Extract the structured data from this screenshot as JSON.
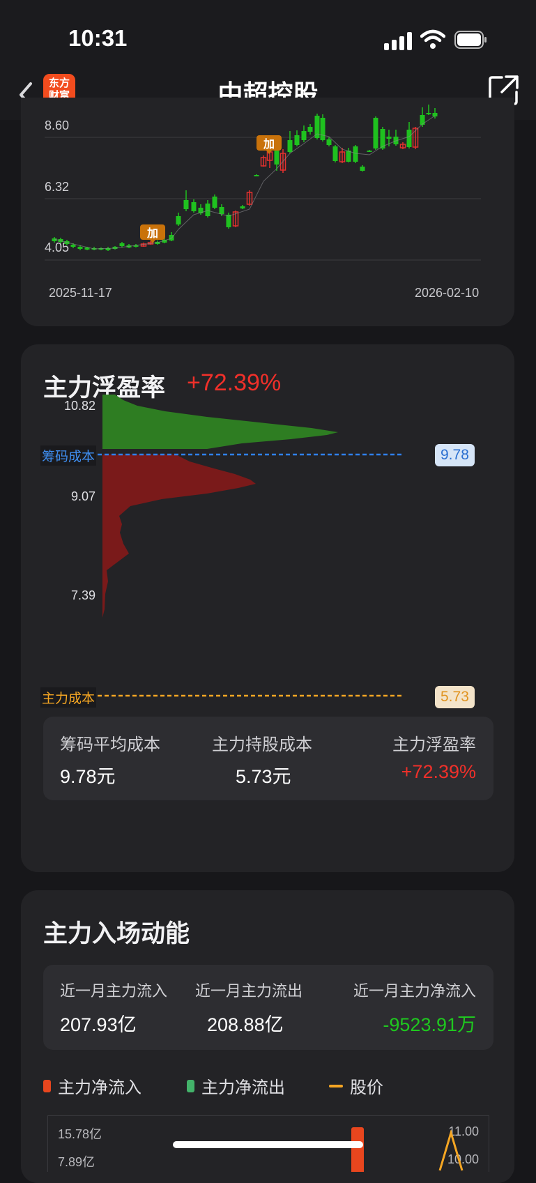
{
  "status_bar": {
    "time": "10:31"
  },
  "nav": {
    "logo_line1": "东方",
    "logo_line2": "财富",
    "title": "中超控股"
  },
  "kline": {
    "price_labels": [
      "8.60",
      "6.32",
      "4.05"
    ],
    "date_start": "2025-11-17",
    "date_end": "2026-02-10",
    "markers": [
      "加",
      "加"
    ],
    "up_color": "#e5312e",
    "down_color": "#1fc11f"
  },
  "profit_card": {
    "title": "主力浮盈率",
    "value": "+72.39%",
    "price_axis": [
      "10.82",
      "9.07",
      "7.39"
    ],
    "chip_cost_tag": "筹码成本",
    "chip_cost_value": "9.78",
    "main_cost_tag": "主力成本",
    "main_cost_value": "5.73",
    "summary": [
      {
        "label": "筹码平均成本",
        "value": "9.78元"
      },
      {
        "label": "主力持股成本",
        "value": "5.73元"
      },
      {
        "label": "主力浮盈率",
        "value": "+72.39%"
      }
    ],
    "colors": {
      "profit": "#2e7d22",
      "loss": "#7a1a1a",
      "chip_line": "#2f80ed",
      "main_line": "#f5a623"
    }
  },
  "flow_card": {
    "title": "主力入场动能",
    "summary": [
      {
        "label": "近一月主力流入",
        "value": "207.93亿"
      },
      {
        "label": "近一月主力流出",
        "value": "208.88亿"
      },
      {
        "label": "近一月主力净流入",
        "value": "-9523.91万"
      }
    ],
    "legend": [
      "主力净流入",
      "主力净流出",
      "股价"
    ],
    "axis_left": [
      "15.78亿",
      "7.89亿"
    ],
    "axis_right": [
      "11.00",
      "10.00"
    ],
    "colors": {
      "inflow": "#e8461e",
      "outflow": "#43b36a",
      "price": "#f5a623"
    }
  }
}
